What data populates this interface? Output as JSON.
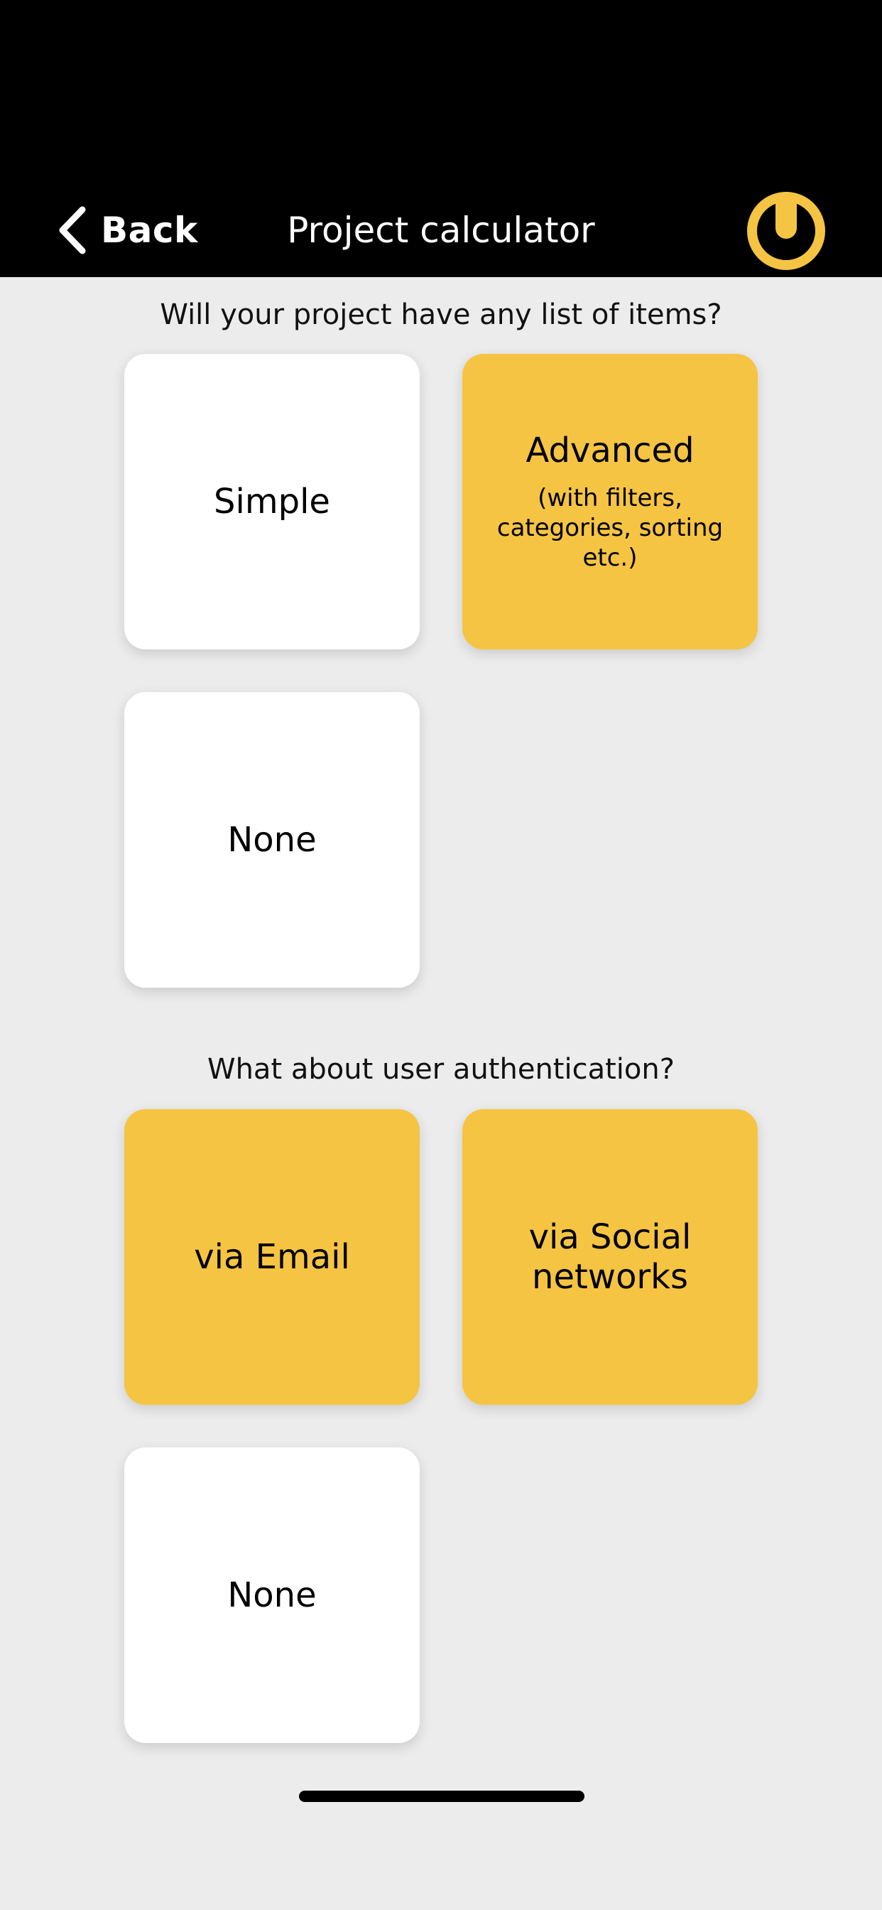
{
  "header": {
    "back_label": "Back",
    "title": "Project calculator",
    "logo_color": "#f5c443",
    "background_color": "#000000"
  },
  "sections": [
    {
      "question": "Will your project have any list of items?",
      "options": [
        {
          "label": "Simple",
          "selected": false
        },
        {
          "label": "Advanced",
          "sublabel": "(with filters, categories, sorting etc.)",
          "selected": true
        },
        {
          "label": "None",
          "selected": false
        }
      ]
    },
    {
      "question": "What about user authentication?",
      "options": [
        {
          "label": "via Email",
          "selected": true
        },
        {
          "label": "via Social networks",
          "selected": true
        },
        {
          "label": "None",
          "selected": false
        }
      ]
    }
  ],
  "colors": {
    "accent": "#f5c443",
    "card": "#ffffff",
    "page_background": "#ececec"
  }
}
